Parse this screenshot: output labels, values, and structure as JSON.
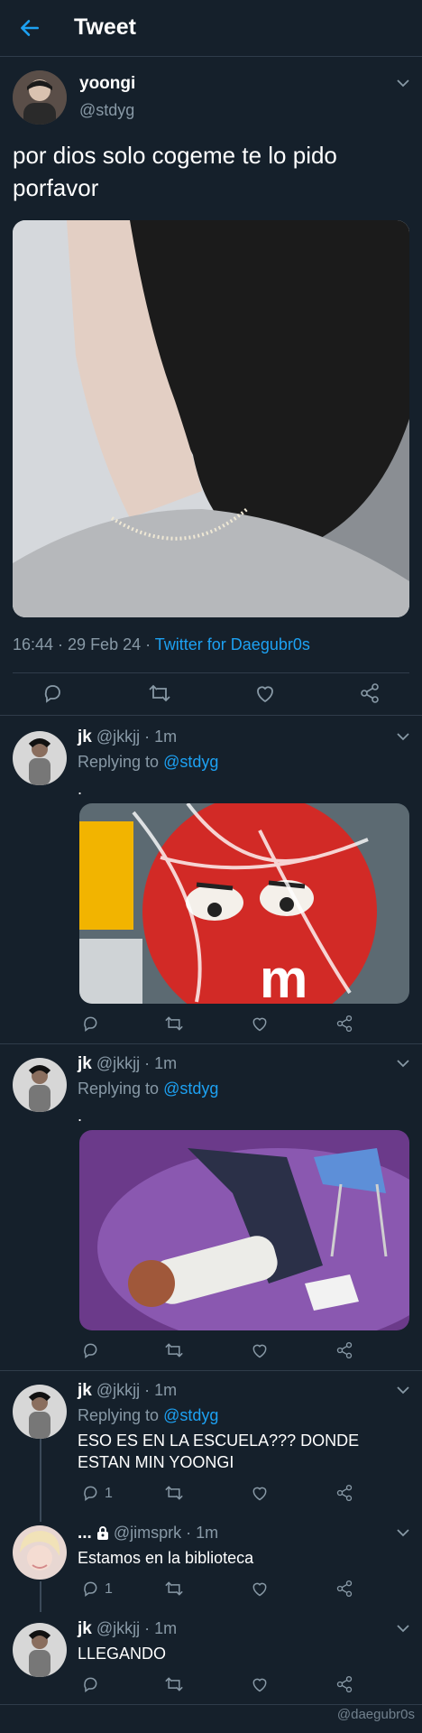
{
  "header": {
    "title": "Tweet"
  },
  "main_tweet": {
    "name": "yoongi",
    "handle": "@stdyg",
    "text": "por dios solo cogeme te lo pido porfavor",
    "meta_time": "16:44 · 29 Feb 24 · ",
    "meta_client": "Twitter for Daegubr0s"
  },
  "replies": [
    {
      "name": "jk",
      "handle": "@jkkjj",
      "time": "· 1m",
      "replying_label": "Replying to ",
      "replying_to": "@stdyg",
      "text": "."
    },
    {
      "name": "jk",
      "handle": "@jkkjj",
      "time": "· 1m",
      "replying_label": "Replying to ",
      "replying_to": "@stdyg",
      "text": "."
    },
    {
      "name": "jk",
      "handle": "@jkkjj",
      "time": "· 1m",
      "replying_label": "Replying to ",
      "replying_to": "@stdyg",
      "text": "ESO ES EN LA ESCUELA??? DONDE ESTAN MIN YOONGI",
      "reply_count": "1"
    },
    {
      "name": "...",
      "handle": "@jimsprk",
      "time": "· 1m",
      "text": "Estamos en la biblioteca",
      "reply_count": "1"
    },
    {
      "name": "jk",
      "handle": "@jkkjj",
      "time": "· 1m",
      "text": "LLEGANDO"
    }
  ],
  "watermark": "@daegubr0s",
  "colors": {
    "background": "#15202b",
    "accent": "#1da1f2",
    "muted": "#8899a6",
    "divider": "#2f3c4a"
  },
  "icons": [
    "back-arrow-icon",
    "chevron-down-icon",
    "reply-icon",
    "retweet-icon",
    "like-icon",
    "share-icon",
    "lock-icon"
  ]
}
